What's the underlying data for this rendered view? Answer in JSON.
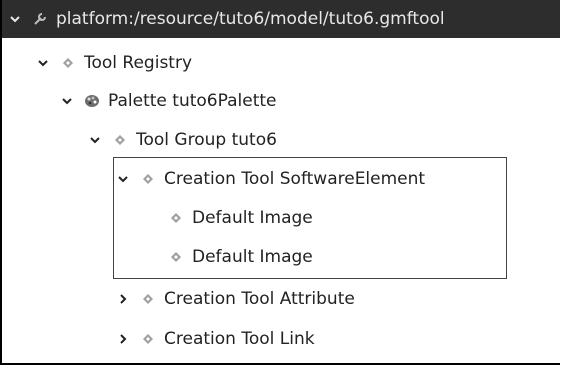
{
  "tree": {
    "root": {
      "label": "platform:/resource/tuto6/model/tuto6.gmftool",
      "icon": "wrench-icon"
    },
    "items": [
      {
        "label": "Tool Registry",
        "icon": "diamond-icon",
        "expanded": true
      },
      {
        "label": "Palette tuto6Palette",
        "icon": "palette-icon",
        "expanded": true
      },
      {
        "label": "Tool Group tuto6",
        "icon": "diamond-icon",
        "expanded": true
      },
      {
        "label": "Creation Tool SoftwareElement",
        "icon": "diamond-icon",
        "expanded": true
      },
      {
        "label": "Default Image",
        "icon": "diamond-icon"
      },
      {
        "label": "Default Image",
        "icon": "diamond-icon"
      },
      {
        "label": "Creation Tool Attribute",
        "icon": "diamond-icon",
        "expanded": false
      },
      {
        "label": "Creation Tool Link",
        "icon": "diamond-icon",
        "expanded": false
      }
    ]
  },
  "colors": {
    "selected_row": "#2d2d2d",
    "selected_text": "#e8e8e8",
    "icon_gray": "#a0a0a0",
    "text": "#222222"
  }
}
